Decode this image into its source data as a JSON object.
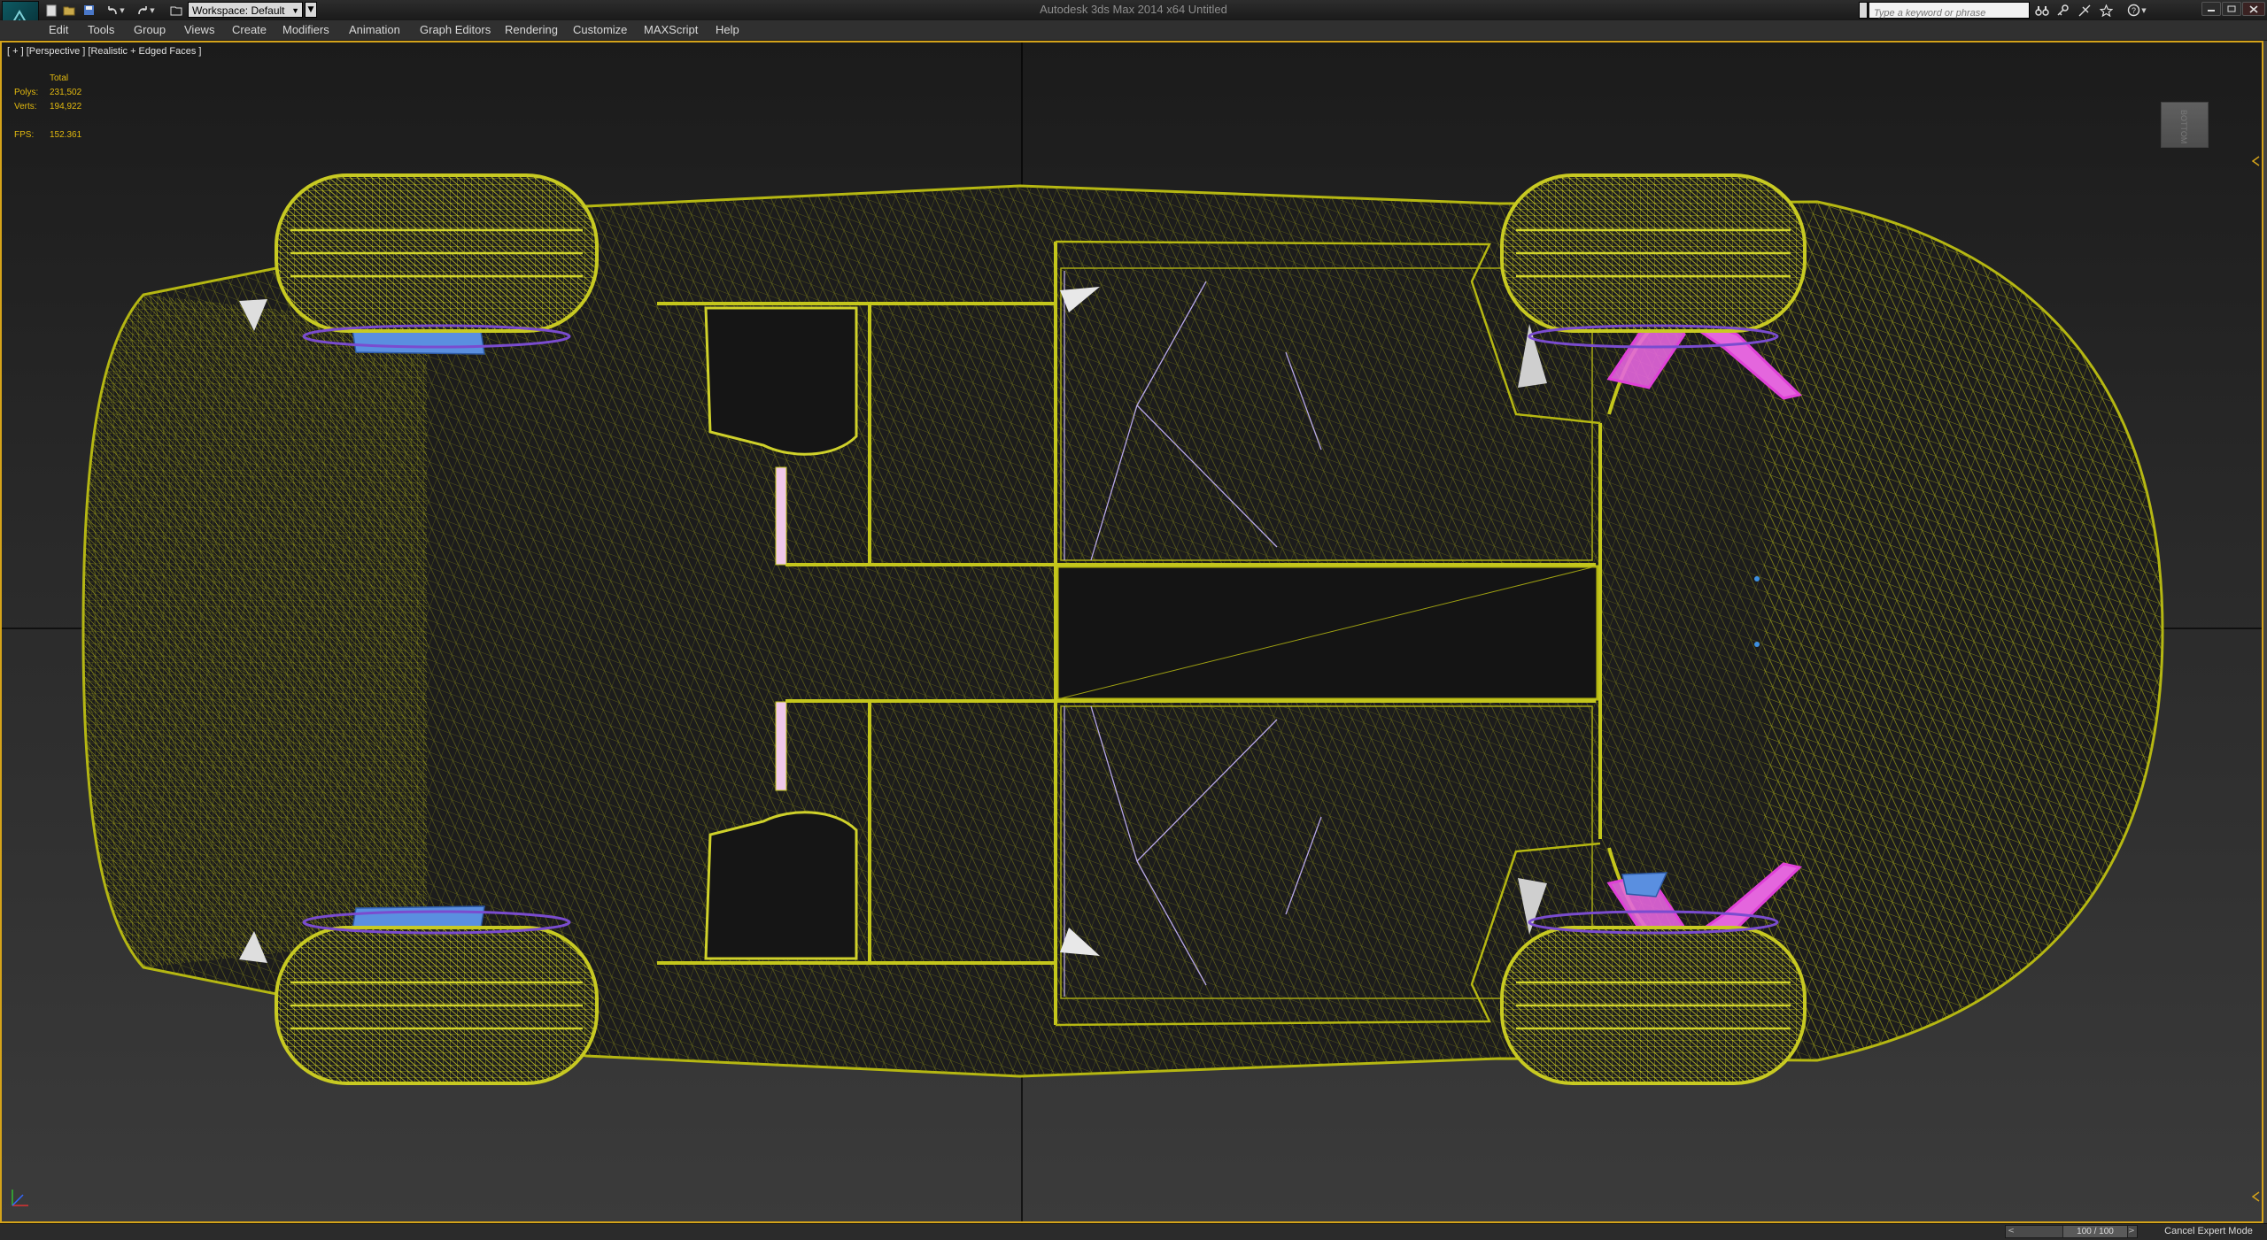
{
  "window": {
    "app_title": "Autodesk 3ds Max  2014 x64     Untitled",
    "workspace": "Workspace: Default",
    "search_placeholder": "Type a keyword or phrase"
  },
  "menu": [
    "Edit",
    "Tools",
    "Group",
    "Views",
    "Create",
    "Modifiers",
    "Animation",
    "Graph Editors",
    "Rendering",
    "Customize",
    "MAXScript",
    "Help"
  ],
  "viewport": {
    "label": "[ + ] [Perspective ] [Realistic + Edged Faces ]",
    "viewcube_label": "BOTTOM",
    "stats": {
      "total_label": "Total",
      "polys_label": "Polys:",
      "polys": "231,502",
      "verts_label": "Verts:",
      "verts": "194,922",
      "fps_label": "FPS:",
      "fps": "152.361"
    }
  },
  "status": {
    "time_slider": "100 / 100",
    "expert_mode": "Cancel Expert Mode"
  },
  "colors": {
    "wire": "#b6b812",
    "suspension": "#e040d8",
    "brake": "#5a8fe0",
    "viewport_border": "#d4a31a"
  },
  "icons": {
    "quick_access": [
      "logo-icon",
      "new-file-icon",
      "open-file-icon",
      "save-icon",
      "undo-icon",
      "redo-icon",
      "project-folder-icon"
    ],
    "infocenter": [
      "binoculars-icon",
      "key-icon",
      "star-icon",
      "help-icon"
    ],
    "window": [
      "minimize-icon",
      "maximize-icon",
      "close-icon"
    ]
  }
}
